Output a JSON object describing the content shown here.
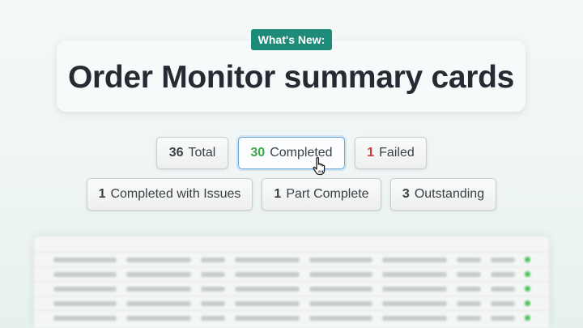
{
  "badge": {
    "label": "What's New:"
  },
  "title": {
    "text": "Order Monitor summary cards"
  },
  "summary_cards": {
    "total": {
      "count": "36",
      "label": "Total"
    },
    "completed": {
      "count": "30",
      "label": "Completed",
      "count_color": "#3aa846"
    },
    "failed": {
      "count": "1",
      "label": "Failed",
      "count_color": "#d23c3c"
    },
    "completed_with_issues": {
      "count": "1",
      "label": "Completed with Issues"
    },
    "part_complete": {
      "count": "1",
      "label": "Part Complete"
    },
    "outstanding": {
      "count": "3",
      "label": "Outstanding"
    }
  },
  "cursor": {
    "icon": "hand-pointer-icon"
  },
  "table": {
    "status_color": "#49c25a",
    "row_status": [
      "green",
      "green",
      "green",
      "green",
      "green"
    ]
  }
}
